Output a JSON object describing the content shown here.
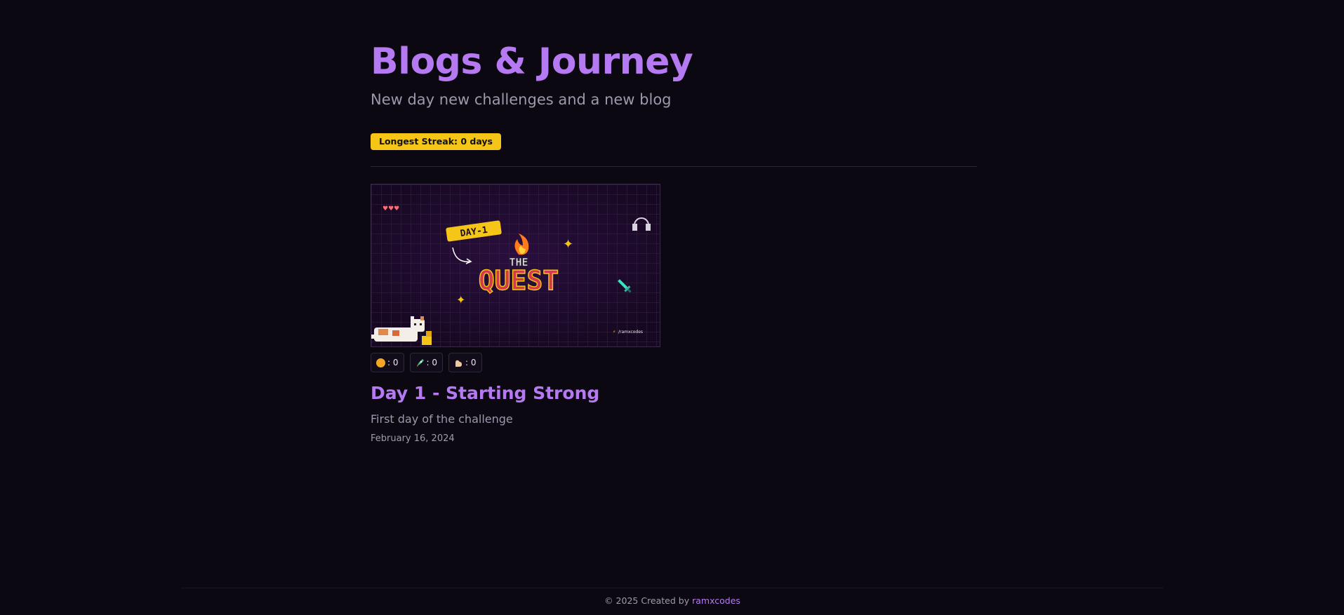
{
  "header": {
    "title": "Blogs & Journey",
    "subtitle": "New day new challenges and a new blog",
    "streak_badge": "Longest Streak: 0 days"
  },
  "posts": [
    {
      "title": "Day 1 - Starting Strong",
      "description": "First day of the challenge",
      "date": "February 16, 2024",
      "image": {
        "badge_text": "DAY-1",
        "logo_top": "THE",
        "logo_main": "QUEST",
        "credit": "/ramxcodes",
        "lives": "♥♥♥"
      },
      "reactions": [
        {
          "icon": "thinking-face-icon",
          "count": ": 0"
        },
        {
          "icon": "rocket-icon",
          "count": ": 0"
        },
        {
          "icon": "flexed-biceps-icon",
          "count": ": 0"
        }
      ]
    }
  ],
  "footer": {
    "prefix": "© 2025 Created by",
    "author": "ramxcodes"
  },
  "colors": {
    "background": "#0c0812",
    "accent": "#b57af2",
    "badge": "#f5c518"
  }
}
